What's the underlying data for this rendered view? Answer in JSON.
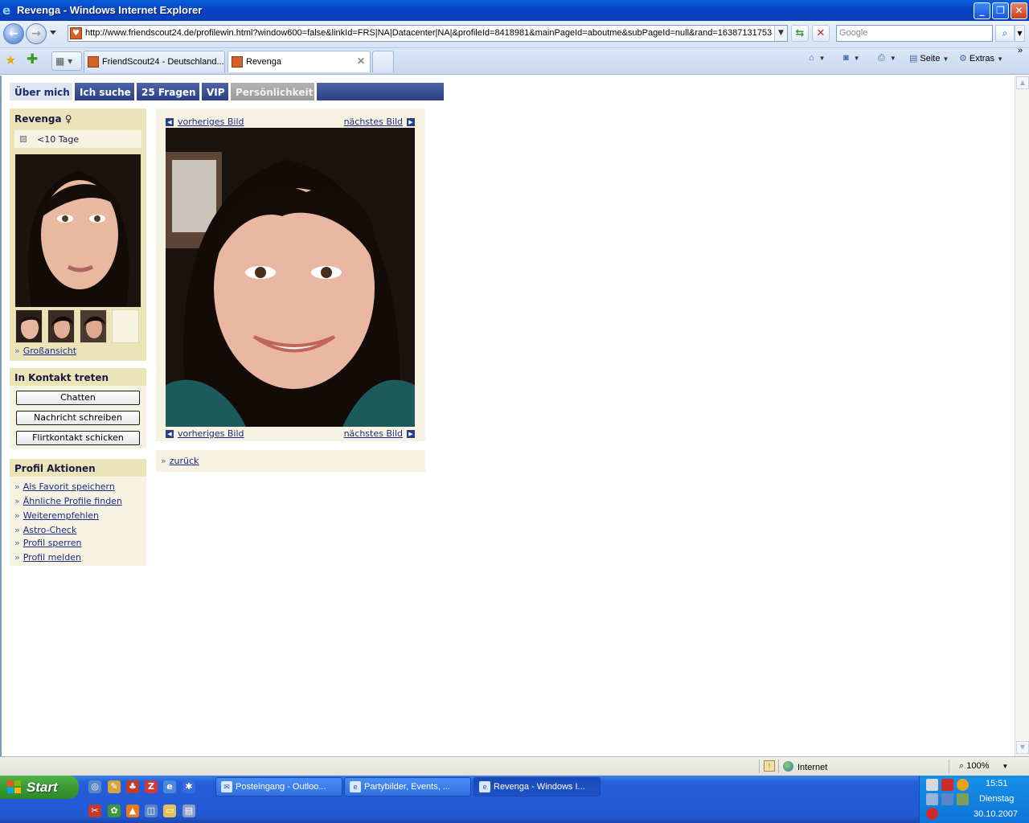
{
  "window": {
    "title": "Revenga - Windows Internet Explorer"
  },
  "address": {
    "url": "http://www.friendscout24.de/profilewin.html?window600=false&linkId=FRS|NA|Datacenter|NA|&profileId=8418981&mainPageId=aboutme&subPageId=null&rand=163871317533",
    "search_placeholder": "Google"
  },
  "tabs": [
    {
      "label": "FriendScout24 - Deutschland..."
    },
    {
      "label": "Revenga"
    }
  ],
  "commandbar": {
    "page": "Seite",
    "tools": "Extras"
  },
  "site": {
    "tabs": [
      "Über mich",
      "Ich suche",
      "25 Fragen",
      "VIP",
      "Persönlichkeit"
    ],
    "profile": {
      "name": "Revenga",
      "gender_symbol": "♀",
      "online": "<10 Tage",
      "large_view_link": "Großansicht"
    },
    "contact": {
      "heading": "In Kontakt treten",
      "chat": "Chatten",
      "message": "Nachricht schreiben",
      "flirt": "Flirtkontakt schicken"
    },
    "actions": {
      "heading": "Profil Aktionen",
      "items": [
        "Als Favorit speichern",
        "Ähnliche Profile finden",
        "Weiterempfehlen",
        "Astro-Check",
        "Profil sperren",
        "Profil melden"
      ]
    },
    "viewer": {
      "prev": "vorheriges Bild",
      "next": "nächstes Bild",
      "back": "zurück"
    }
  },
  "statusbar": {
    "zone": "Internet",
    "zoom": "100%"
  },
  "taskbar": {
    "start": "Start",
    "items": [
      "Posteingang - Outloo...",
      "Partybilder, Events, ...",
      "Revenga - Windows I..."
    ],
    "clock": "15:51",
    "day": "Dienstag",
    "date": "30.10.2007"
  },
  "colors": {
    "titlebar": "#0a5fdc",
    "sidebox": "#ece4b9",
    "sidebox_light": "#f7f3e3",
    "site_tab": "#2a3f87",
    "link": "#1a2a8a"
  }
}
